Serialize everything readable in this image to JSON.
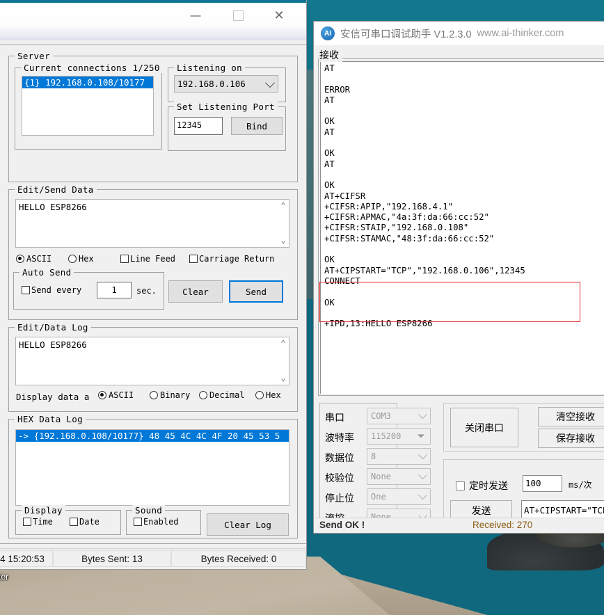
{
  "desktop": {
    "icon_label_partial": "ter"
  },
  "left_window": {
    "titlebar": {
      "minimize": "—",
      "maximize": "▢",
      "close": "✕"
    },
    "server_group": {
      "title": "Server",
      "connections_group": {
        "title": "Current connections 1/250",
        "items": [
          "{1} 192.168.0.108/10177"
        ]
      },
      "listening_group": {
        "title": "Listening on",
        "selected": "192.168.0.106"
      },
      "port_group": {
        "title": "Set Listening Port",
        "port_value": "12345",
        "bind_label": "Bind"
      }
    },
    "send_group": {
      "title": "Edit/Send Data",
      "text_value": "HELLO ESP8266",
      "format_ascii": "ASCII",
      "format_hex": "Hex",
      "format_selected": "ASCII",
      "line_feed": "Line Feed",
      "carriage_return": "Carriage Return",
      "auto_send": {
        "title": "Auto Send",
        "send_every": "Send every",
        "interval": "1",
        "unit": "sec."
      },
      "clear_label": "Clear",
      "send_label": "Send"
    },
    "log_group": {
      "title": "Edit/Data Log",
      "text_value": "HELLO ESP8266",
      "display_prefix": "Display data a",
      "options": [
        "ASCII",
        "Binary",
        "Decimal",
        "Hex"
      ],
      "selected": "ASCII"
    },
    "hex_group": {
      "title": "HEX Data Log",
      "rows": [
        "-> {192.168.0.108/10177}  48 45 4C 4C 4F 20 45 53 5"
      ],
      "display_group": {
        "title": "Display",
        "time": "Time",
        "date": "Date"
      },
      "sound_group": {
        "title": "Sound",
        "enabled": "Enabled"
      },
      "clear_log_label": "Clear Log"
    },
    "statusbar": {
      "time": "4 15:20:53",
      "bytes_sent": "Bytes Sent: 13",
      "bytes_received": "Bytes Received: 0"
    }
  },
  "right_window": {
    "title_app": "安信可串口调试助手 V1.2.3.0",
    "title_url": "www.ai-thinker.com",
    "receive_label": "接收",
    "receive_text": "AT\n\nERROR\nAT\n\nOK\nAT\n\nOK\nAT\n\nOK\nAT+CIFSR\n+CIFSR:APIP,\"192.168.4.1\"\n+CIFSR:APMAC,\"4a:3f:da:66:cc:52\"\n+CIFSR:STAIP,\"192.168.0.108\"\n+CIFSR:STAMAC,\"48:3f:da:66:cc:52\"\n\nOK\nAT+CIPSTART=\"TCP\",\"192.168.0.106\",12345\nCONNECT\n\nOK\n\n+IPD,13:HELLO ESP8266",
    "serial_settings": {
      "labels": [
        "串口",
        "波特率",
        "数据位",
        "校验位",
        "停止位",
        "流控"
      ],
      "values": [
        "COM3",
        "115200",
        "8",
        "None",
        "One",
        "None"
      ]
    },
    "close_port_label": "关闭串口",
    "clear_recv_label": "清空接收",
    "save_recv_label": "保存接收",
    "timed_send_label": "定时发送",
    "timed_send_value": "100",
    "timed_send_unit": "ms/次",
    "send_button_label": "发送",
    "send_input_value": "AT+CIPSTART=\"TCP",
    "statusbar": {
      "send_status": "Send OK !",
      "received": "Received: 270"
    },
    "highlight_color": "#e02020"
  }
}
